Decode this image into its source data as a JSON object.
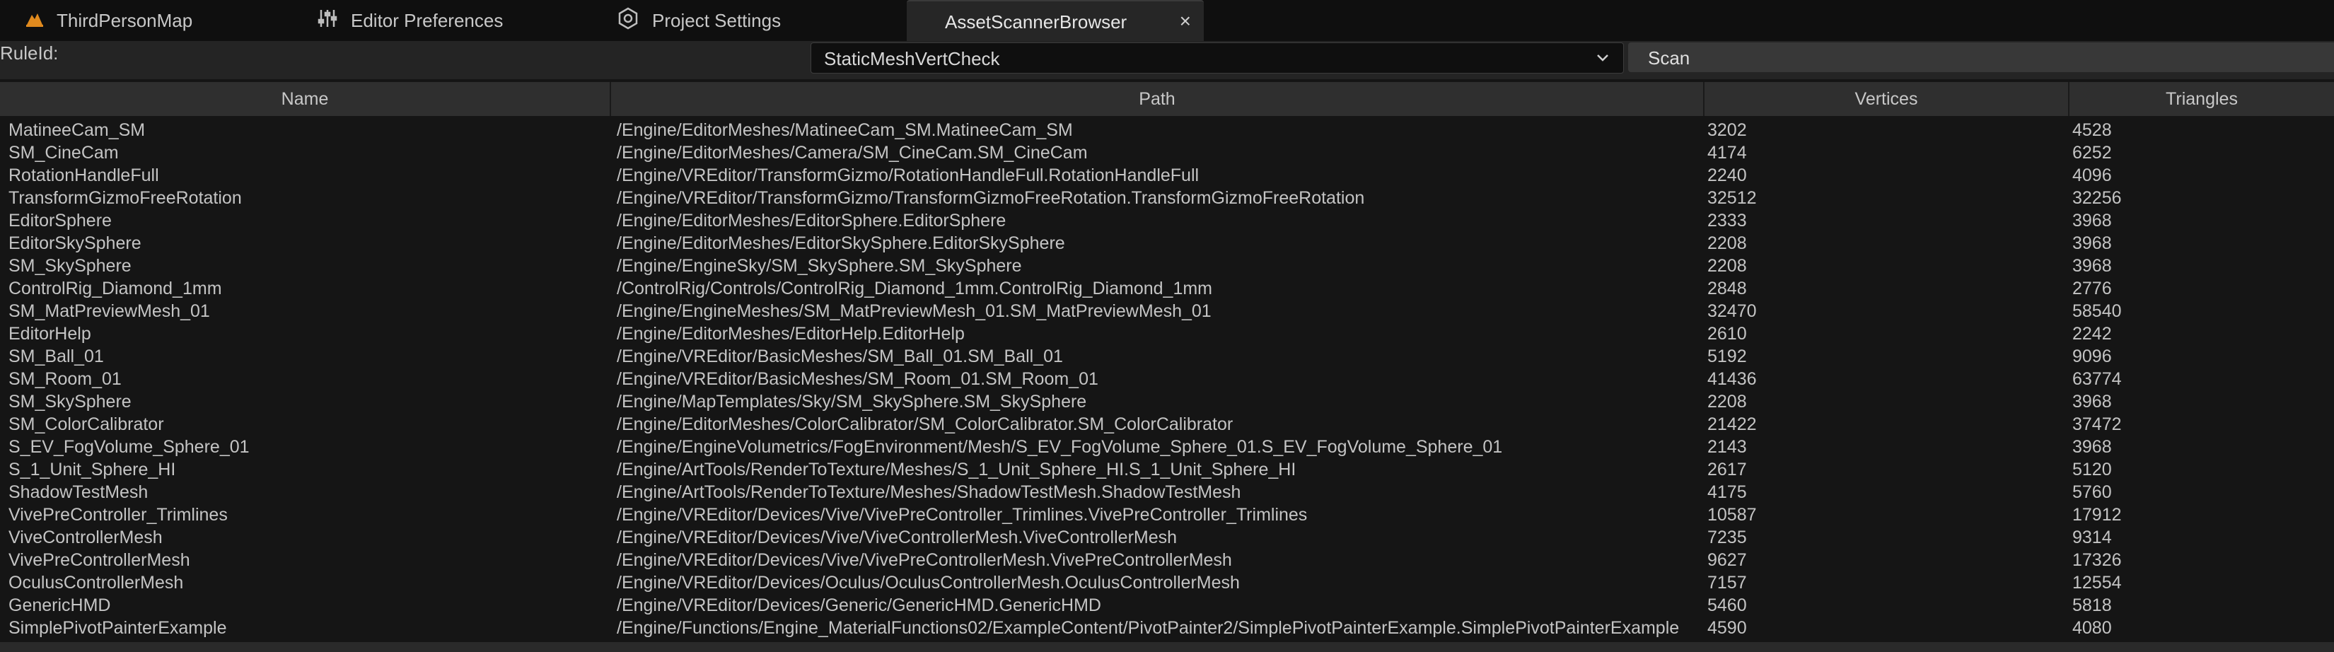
{
  "tabs": [
    {
      "label": "ThirdPersonMap",
      "icon": "level-icon"
    },
    {
      "label": "Editor Preferences",
      "icon": "sliders-icon"
    },
    {
      "label": "Project Settings",
      "icon": "settings-icon"
    },
    {
      "label": "AssetScannerBrowser",
      "icon": "",
      "close": "×"
    }
  ],
  "toolbar": {
    "ruleid_label": "RuleId:",
    "rule_value": "StaticMeshVertCheck",
    "scan_label": "Scan"
  },
  "table": {
    "columns": [
      "Name",
      "Path",
      "Vertices",
      "Triangles"
    ],
    "rows": [
      {
        "name": "MatineeCam_SM",
        "path": "/Engine/EditorMeshes/MatineeCam_SM.MatineeCam_SM",
        "vertices": "3202",
        "triangles": "4528"
      },
      {
        "name": "SM_CineCam",
        "path": "/Engine/EditorMeshes/Camera/SM_CineCam.SM_CineCam",
        "vertices": "4174",
        "triangles": "6252"
      },
      {
        "name": "RotationHandleFull",
        "path": "/Engine/VREditor/TransformGizmo/RotationHandleFull.RotationHandleFull",
        "vertices": "2240",
        "triangles": "4096"
      },
      {
        "name": "TransformGizmoFreeRotation",
        "path": "/Engine/VREditor/TransformGizmo/TransformGizmoFreeRotation.TransformGizmoFreeRotation",
        "vertices": "32512",
        "triangles": "32256"
      },
      {
        "name": "EditorSphere",
        "path": "/Engine/EditorMeshes/EditorSphere.EditorSphere",
        "vertices": "2333",
        "triangles": "3968"
      },
      {
        "name": "EditorSkySphere",
        "path": "/Engine/EditorMeshes/EditorSkySphere.EditorSkySphere",
        "vertices": "2208",
        "triangles": "3968"
      },
      {
        "name": "SM_SkySphere",
        "path": "/Engine/EngineSky/SM_SkySphere.SM_SkySphere",
        "vertices": "2208",
        "triangles": "3968"
      },
      {
        "name": "ControlRig_Diamond_1mm",
        "path": "/ControlRig/Controls/ControlRig_Diamond_1mm.ControlRig_Diamond_1mm",
        "vertices": "2848",
        "triangles": "2776"
      },
      {
        "name": "SM_MatPreviewMesh_01",
        "path": "/Engine/EngineMeshes/SM_MatPreviewMesh_01.SM_MatPreviewMesh_01",
        "vertices": "32470",
        "triangles": "58540"
      },
      {
        "name": "EditorHelp",
        "path": "/Engine/EditorMeshes/EditorHelp.EditorHelp",
        "vertices": "2610",
        "triangles": "2242"
      },
      {
        "name": "SM_Ball_01",
        "path": "/Engine/VREditor/BasicMeshes/SM_Ball_01.SM_Ball_01",
        "vertices": "5192",
        "triangles": "9096"
      },
      {
        "name": "SM_Room_01",
        "path": "/Engine/VREditor/BasicMeshes/SM_Room_01.SM_Room_01",
        "vertices": "41436",
        "triangles": "63774"
      },
      {
        "name": "SM_SkySphere",
        "path": "/Engine/MapTemplates/Sky/SM_SkySphere.SM_SkySphere",
        "vertices": "2208",
        "triangles": "3968"
      },
      {
        "name": "SM_ColorCalibrator",
        "path": "/Engine/EditorMeshes/ColorCalibrator/SM_ColorCalibrator.SM_ColorCalibrator",
        "vertices": "21422",
        "triangles": "37472"
      },
      {
        "name": "S_EV_FogVolume_Sphere_01",
        "path": "/Engine/EngineVolumetrics/FogEnvironment/Mesh/S_EV_FogVolume_Sphere_01.S_EV_FogVolume_Sphere_01",
        "vertices": "2143",
        "triangles": "3968"
      },
      {
        "name": "S_1_Unit_Sphere_HI",
        "path": "/Engine/ArtTools/RenderToTexture/Meshes/S_1_Unit_Sphere_HI.S_1_Unit_Sphere_HI",
        "vertices": "2617",
        "triangles": "5120"
      },
      {
        "name": "ShadowTestMesh",
        "path": "/Engine/ArtTools/RenderToTexture/Meshes/ShadowTestMesh.ShadowTestMesh",
        "vertices": "4175",
        "triangles": "5760"
      },
      {
        "name": "VivePreController_Trimlines",
        "path": "/Engine/VREditor/Devices/Vive/VivePreController_Trimlines.VivePreController_Trimlines",
        "vertices": "10587",
        "triangles": "17912"
      },
      {
        "name": "ViveControllerMesh",
        "path": "/Engine/VREditor/Devices/Vive/ViveControllerMesh.ViveControllerMesh",
        "vertices": "7235",
        "triangles": "9314"
      },
      {
        "name": "VivePreControllerMesh",
        "path": "/Engine/VREditor/Devices/Vive/VivePreControllerMesh.VivePreControllerMesh",
        "vertices": "9627",
        "triangles": "17326"
      },
      {
        "name": "OculusControllerMesh",
        "path": "/Engine/VREditor/Devices/Oculus/OculusControllerMesh.OculusControllerMesh",
        "vertices": "7157",
        "triangles": "12554"
      },
      {
        "name": "GenericHMD",
        "path": "/Engine/VREditor/Devices/Generic/GenericHMD.GenericHMD",
        "vertices": "5460",
        "triangles": "5818"
      },
      {
        "name": "SimplePivotPainterExample",
        "path": "/Engine/Functions/Engine_MaterialFunctions02/ExampleContent/PivotPainter2/SimplePivotPainterExample.SimplePivotPainterExample",
        "vertices": "4590",
        "triangles": "4080"
      }
    ]
  },
  "colors": {
    "background": "#151515",
    "tabbar": "#0f0f0f",
    "active_tab": "#262626",
    "header": "#2f2f2f",
    "text": "#c4c4c4",
    "level_icon_orange": "#e08a1e"
  }
}
